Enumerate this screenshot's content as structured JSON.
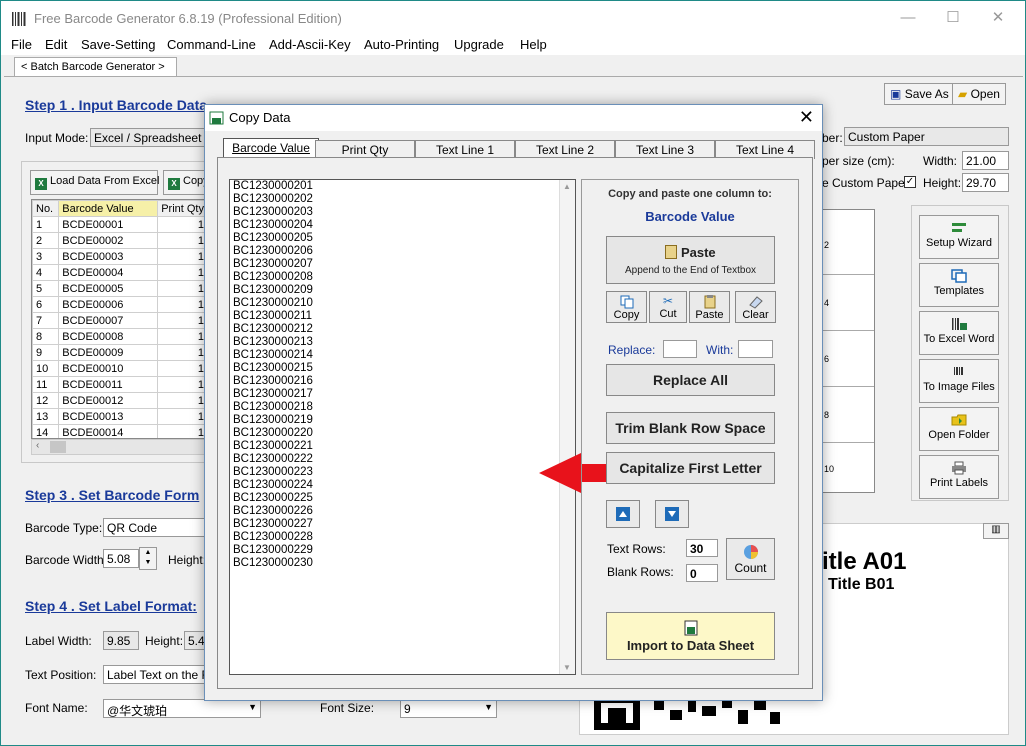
{
  "app": {
    "title": "Free Barcode Generator  6.8.19  (Professional Edition)"
  },
  "menu": [
    "File",
    "Edit",
    "Save-Setting",
    "Command-Line",
    "Add-Ascii-Key",
    "Auto-Printing",
    "Upgrade",
    "Help"
  ],
  "tab_label": "< Batch Barcode Generator >",
  "step1": {
    "title": "Step 1 .  Input Barcode Data",
    "input_mode_label": "Input Mode:",
    "input_mode_value": "Excel / Spreadsheet",
    "load_btn": "Load Data From Excel",
    "copy_btn": "Copy",
    "columns": [
      "No.",
      "Barcode Value",
      "Print Qty"
    ],
    "rows": [
      [
        "1",
        "BCDE00001",
        "1"
      ],
      [
        "2",
        "BCDE00002",
        "1"
      ],
      [
        "3",
        "BCDE00003",
        "1"
      ],
      [
        "4",
        "BCDE00004",
        "1"
      ],
      [
        "5",
        "BCDE00005",
        "1"
      ],
      [
        "6",
        "BCDE00006",
        "1"
      ],
      [
        "7",
        "BCDE00007",
        "1"
      ],
      [
        "8",
        "BCDE00008",
        "1"
      ],
      [
        "9",
        "BCDE00009",
        "1"
      ],
      [
        "10",
        "BCDE00010",
        "1"
      ],
      [
        "11",
        "BCDE00011",
        "1"
      ],
      [
        "12",
        "BCDE00012",
        "1"
      ],
      [
        "13",
        "BCDE00013",
        "1"
      ],
      [
        "14",
        "BCDE00014",
        "1"
      ]
    ]
  },
  "step2": {
    "paper_label": "ber:",
    "paper_value": "Custom Paper",
    "paper_size_label": "per size (cm):",
    "width_label": "Width:",
    "width_value": "21.00",
    "custom_paper_label": "e Custom Paper:",
    "height_label": "Height:",
    "height_value": "29.70",
    "save_as": "Save As",
    "open": "Open"
  },
  "step3": {
    "title": "Step 3 . Set Barcode Form",
    "type_label": "Barcode Type:",
    "type_value": "QR Code",
    "width_label": "Barcode Width:",
    "width_value": "5.08",
    "height_label": "Height:"
  },
  "step4": {
    "title": "Step 4 . Set Label Format:",
    "label_width_label": "Label Width:",
    "label_width_value": "9.85",
    "height_label": "Height:",
    "height_value": "5.4",
    "text_position_label": "Text Position:",
    "text_position_value": "Label Text on the Ri",
    "font_name_label": "Font Name:",
    "font_name_value": "@华文琥珀",
    "font_size_label": "Font Size:",
    "font_size_value": "9"
  },
  "right_buttons": [
    "Setup Wizard",
    "Templates",
    "To Excel Word",
    "To Image Files",
    "Open Folder",
    "Print Labels"
  ],
  "sheet_numbers": [
    "2",
    "4",
    "6",
    "8",
    "10"
  ],
  "preview": {
    "title_a": "itle A01",
    "title_b": "Title B01"
  },
  "dialog": {
    "title": "Copy Data",
    "tabs": [
      "Barcode Value",
      "Print Qty",
      "Text Line 1",
      "Text Line 2",
      "Text Line 3",
      "Text Line 4"
    ],
    "lines": [
      "BC1230000201",
      "BC1230000202",
      "BC1230000203",
      "BC1230000204",
      "BC1230000205",
      "BC1230000206",
      "BC1230000207",
      "BC1230000208",
      "BC1230000209",
      "BC1230000210",
      "BC1230000211",
      "BC1230000212",
      "BC1230000213",
      "BC1230000214",
      "BC1230000215",
      "BC1230000216",
      "BC1230000217",
      "BC1230000218",
      "BC1230000219",
      "BC1230000220",
      "BC1230000221",
      "BC1230000222",
      "BC1230000223",
      "BC1230000224",
      "BC1230000225",
      "BC1230000226",
      "BC1230000227",
      "BC1230000228",
      "BC1230000229",
      "BC1230000230"
    ],
    "copy_paste_label": "Copy and paste one column to:",
    "target": "Barcode Value",
    "paste": "Paste",
    "paste_sub": "Append to the End of Textbox",
    "copy": "Copy",
    "cut": "Cut",
    "paste_small": "Paste",
    "clear": "Clear",
    "replace_label": "Replace:",
    "with_label": "With:",
    "replace_all": "Replace All",
    "trim": "Trim Blank Row Space",
    "capitalize": "Capitalize First Letter",
    "text_rows_label": "Text Rows:",
    "text_rows_value": "30",
    "blank_rows_label": "Blank Rows:",
    "blank_rows_value": "0",
    "count": "Count",
    "import": "Import to Data Sheet"
  },
  "colors": {
    "step_title": "#1a3a9a",
    "target_label": "#1a3a9a",
    "arrow": "#e8121b",
    "window_border": "#1f8a87"
  }
}
